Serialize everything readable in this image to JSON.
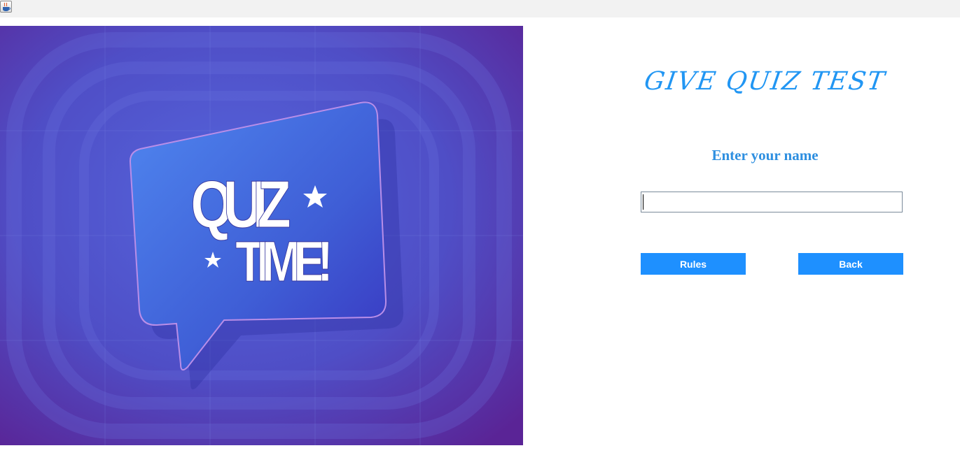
{
  "window": {
    "icon": "java-coffee-cup-icon"
  },
  "hero": {
    "image": "quiz-time-speech-bubble-illustration",
    "line1": "QUIZ",
    "line2": "TIME!",
    "background": "#5a3fc0"
  },
  "form": {
    "title": "GIVE QUIZ TEST",
    "name_label": "Enter your name",
    "name_value": "",
    "name_placeholder": ""
  },
  "buttons": {
    "rules": "Rules",
    "back": "Back"
  },
  "colors": {
    "accent": "#1e90ff",
    "title": "#2196f3",
    "button_text": "#ffffff"
  }
}
